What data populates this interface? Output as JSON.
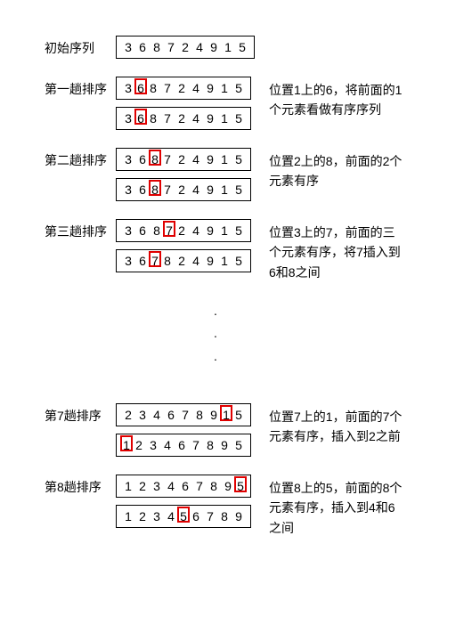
{
  "initial": {
    "label": "初始序列",
    "arr": [
      "3",
      "6",
      "8",
      "7",
      "2",
      "4",
      "9",
      "1",
      "5"
    ]
  },
  "steps": [
    {
      "label": "第一趟排序",
      "before": [
        "3",
        "6",
        "8",
        "7",
        "2",
        "4",
        "9",
        "1",
        "5"
      ],
      "before_hl": 1,
      "after": [
        "3",
        "6",
        "8",
        "7",
        "2",
        "4",
        "9",
        "1",
        "5"
      ],
      "after_hl": 1,
      "desc": "位置1上的6，将前面的1个元素看做有序序列"
    },
    {
      "label": "第二趟排序",
      "before": [
        "3",
        "6",
        "8",
        "7",
        "2",
        "4",
        "9",
        "1",
        "5"
      ],
      "before_hl": 2,
      "after": [
        "3",
        "6",
        "8",
        "7",
        "2",
        "4",
        "9",
        "1",
        "5"
      ],
      "after_hl": 2,
      "desc": "位置2上的8，前面的2个元素有序"
    },
    {
      "label": "第三趟排序",
      "before": [
        "3",
        "6",
        "8",
        "7",
        "2",
        "4",
        "9",
        "1",
        "5"
      ],
      "before_hl": 3,
      "after": [
        "3",
        "6",
        "7",
        "8",
        "2",
        "4",
        "9",
        "1",
        "5"
      ],
      "after_hl": 2,
      "desc": "位置3上的7，前面的三个元素有序，将7插入到6和8之间"
    }
  ],
  "later_steps": [
    {
      "label": "第7趟排序",
      "before": [
        "2",
        "3",
        "4",
        "6",
        "7",
        "8",
        "9",
        "1",
        "5"
      ],
      "before_hl": 7,
      "after": [
        "1",
        "2",
        "3",
        "4",
        "6",
        "7",
        "8",
        "9",
        "5"
      ],
      "after_hl": 0,
      "desc": "位置7上的1，前面的7个元素有序，插入到2之前"
    },
    {
      "label": "第8趟排序",
      "before": [
        "1",
        "2",
        "3",
        "4",
        "6",
        "7",
        "8",
        "9",
        "5"
      ],
      "before_hl": 8,
      "after": [
        "1",
        "2",
        "3",
        "4",
        "5",
        "6",
        "7",
        "8",
        "9"
      ],
      "after_hl": 4,
      "desc": "位置8上的5，前面的8个元素有序，插入到4和6之间"
    }
  ],
  "ellipsis": "."
}
